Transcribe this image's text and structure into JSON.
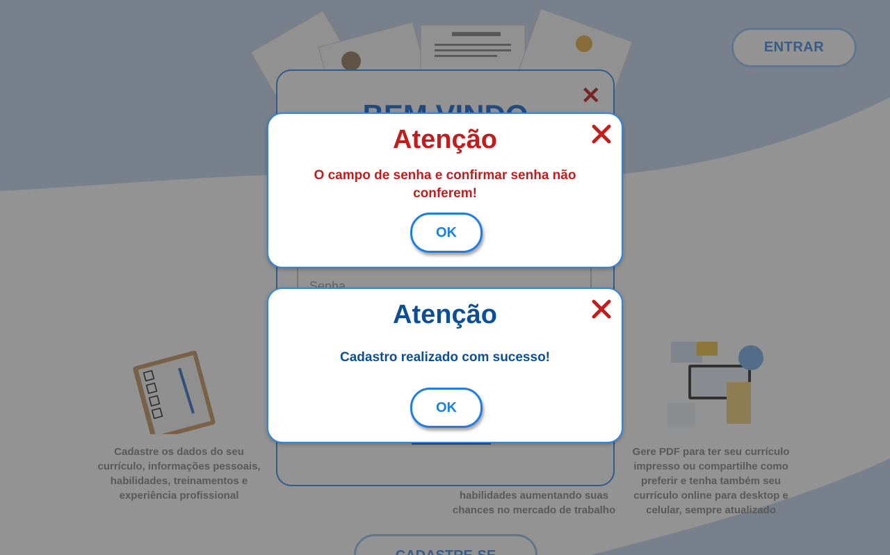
{
  "header": {
    "login_button": "ENTRAR"
  },
  "features": [
    {
      "text": "Cadastre os dados do seu currículo, informações pessoais, habilidades, treinamentos e experiência profissional"
    },
    {
      "text": "habilidades aumentando suas chances no mercado de trabalho"
    },
    {
      "text": "Gere PDF para ter seu currículo impresso ou compartilhe como preferir e tenha também seu currículo online para desktop e celular, sempre atualizado"
    }
  ],
  "signup_button": "CADASTRE-SE",
  "welcome_modal": {
    "title": "BEM VINDO",
    "password_placeholder": "Senha"
  },
  "alerts": [
    {
      "title": "Atenção",
      "message": "O campo de senha e confirmar senha não conferem!",
      "ok_label": "OK",
      "type": "error"
    },
    {
      "title": "Atenção",
      "message": "Cadastro realizado com sucesso!",
      "ok_label": "OK",
      "type": "success"
    }
  ],
  "colors": {
    "primary": "#1b7ee8",
    "error": "#c41c1c",
    "success_text": "#0d4f96",
    "wave": "#c9d9ef"
  }
}
